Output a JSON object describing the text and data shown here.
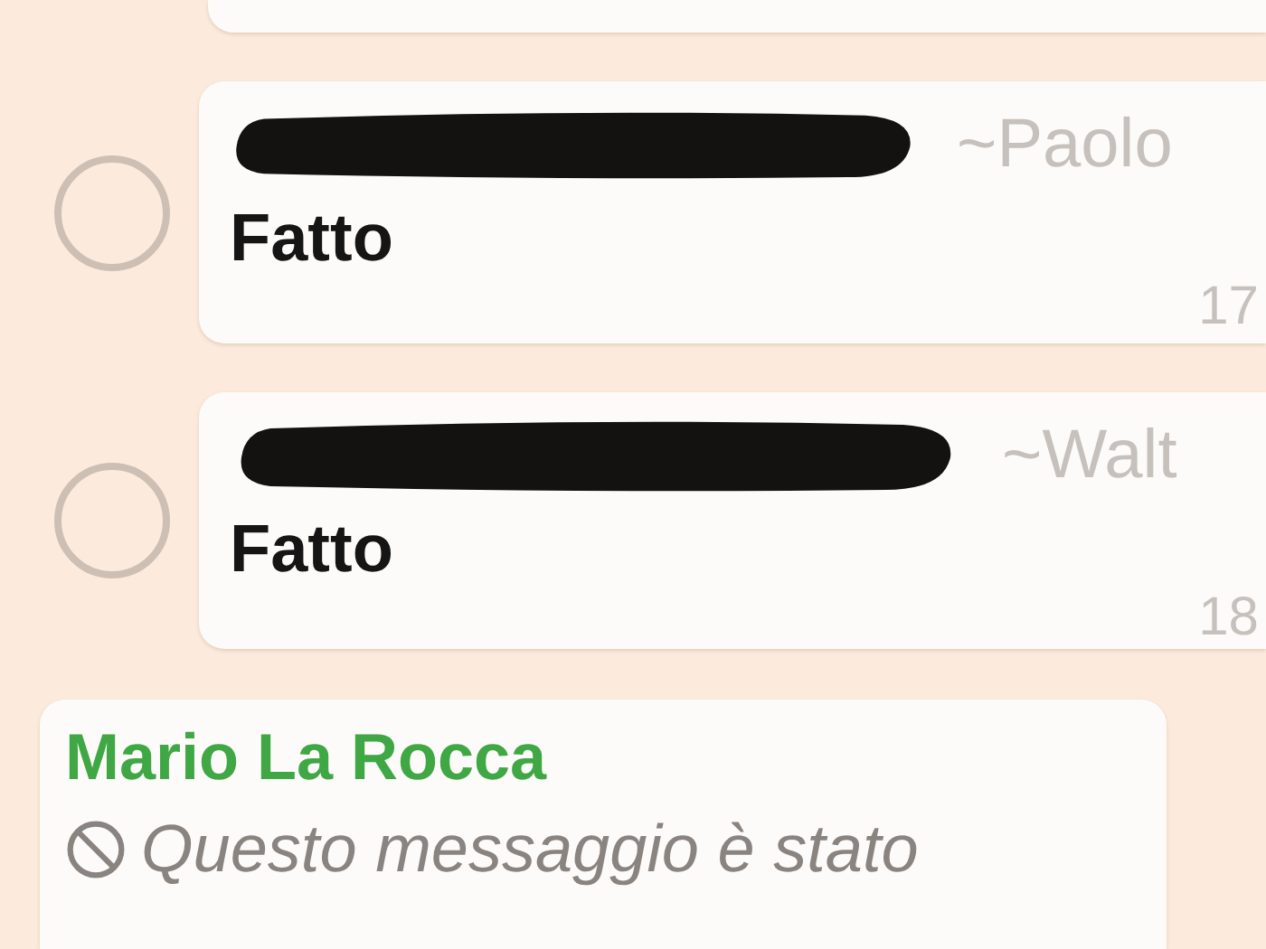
{
  "messages": [
    {
      "kind": "text",
      "selected": false,
      "sender": "~Paolo",
      "text": "Fatto",
      "time": "17"
    },
    {
      "kind": "text",
      "selected": false,
      "sender": "~Walt",
      "text": "Fatto",
      "time": "18"
    },
    {
      "kind": "deleted",
      "sender": "Mario La Rocca",
      "color": "#3fa845",
      "text": "Questo messaggio è stato"
    }
  ]
}
